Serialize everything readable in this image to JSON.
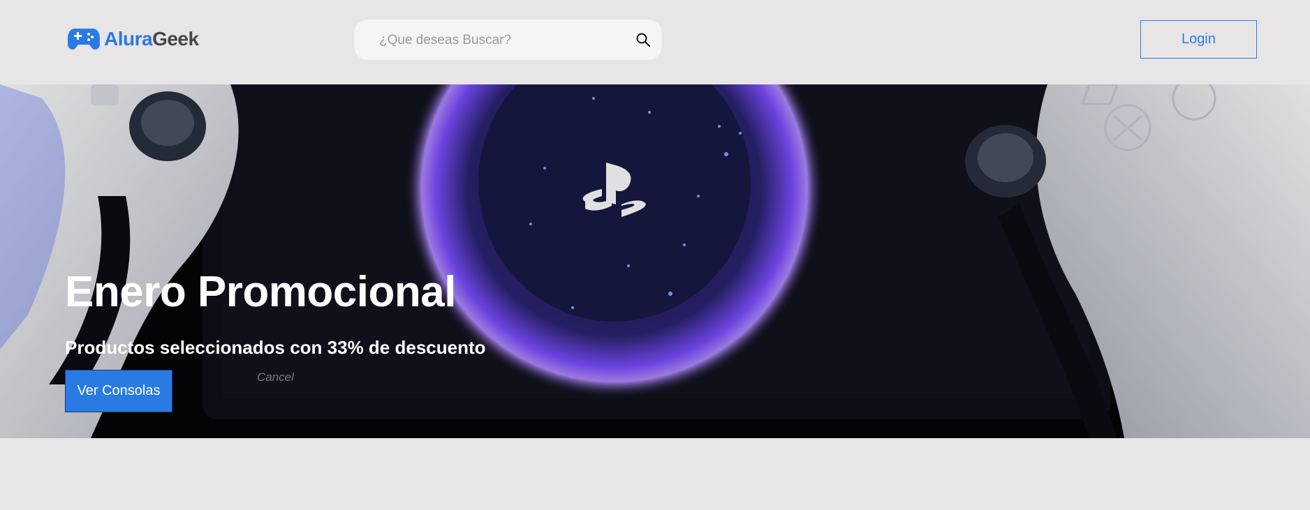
{
  "header": {
    "logo": {
      "part1": "Alura",
      "part2": "Geek",
      "icon": "gamepad-icon"
    },
    "search": {
      "placeholder": "¿Que deseas Buscar?",
      "value": "",
      "icon": "search-icon"
    },
    "login_label": "Login"
  },
  "hero": {
    "title": "Enero Promocional",
    "subtitle": "Productos seleccionados con 33% de descuento",
    "button_label": "Ver Consolas",
    "image_text": "Cancel"
  },
  "colors": {
    "accent": "#2a7ae4",
    "background": "#e7e5e6",
    "hero_glow": "#7b4dff"
  }
}
